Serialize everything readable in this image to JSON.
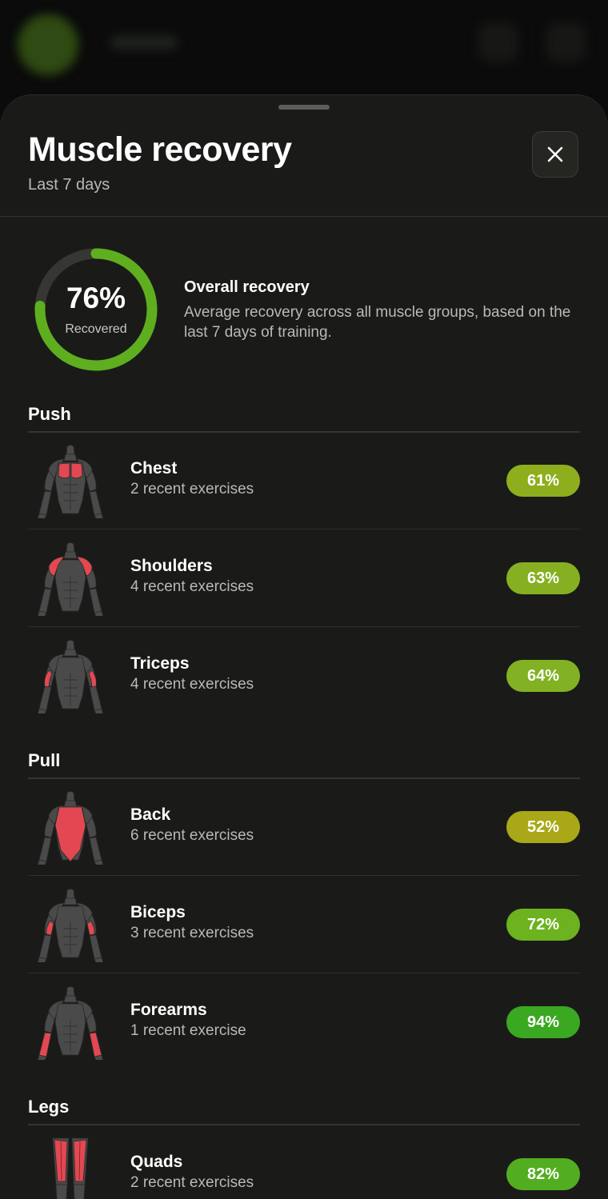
{
  "sheet": {
    "title": "Muscle recovery",
    "subtitle": "Last 7 days"
  },
  "overall": {
    "value": "76%",
    "label": "Recovered",
    "fraction": 0.76,
    "title": "Overall recovery",
    "description": "Average recovery across all muscle groups, based on the last 7 days of training."
  },
  "sections": [
    {
      "title": "Push"
    },
    {
      "title": "Pull"
    },
    {
      "title": "Legs"
    }
  ],
  "muscles": [
    {
      "name": "Chest",
      "sub": "2 recent exercises",
      "value": "61%",
      "color": "#8fae1d",
      "region": "chest"
    },
    {
      "name": "Shoulders",
      "sub": "4 recent exercises",
      "value": "63%",
      "color": "#86b021",
      "region": "shoulders"
    },
    {
      "name": "Triceps",
      "sub": "4 recent exercises",
      "value": "64%",
      "color": "#82b124",
      "region": "triceps"
    },
    {
      "name": "Back",
      "sub": "6 recent exercises",
      "value": "52%",
      "color": "#a8a818",
      "region": "back"
    },
    {
      "name": "Biceps",
      "sub": "3 recent exercises",
      "value": "72%",
      "color": "#6db21f",
      "region": "biceps"
    },
    {
      "name": "Forearms",
      "sub": "1 recent exercise",
      "value": "94%",
      "color": "#3aa821",
      "region": "forearms"
    },
    {
      "name": "Quads",
      "sub": "2 recent exercises",
      "value": "82%",
      "color": "#52ae20",
      "region": "quads"
    }
  ],
  "colors": {
    "accent": "#5fae1f",
    "ring_track": "#353733",
    "highlight": "#e34852",
    "body": "#4a4a4a"
  }
}
